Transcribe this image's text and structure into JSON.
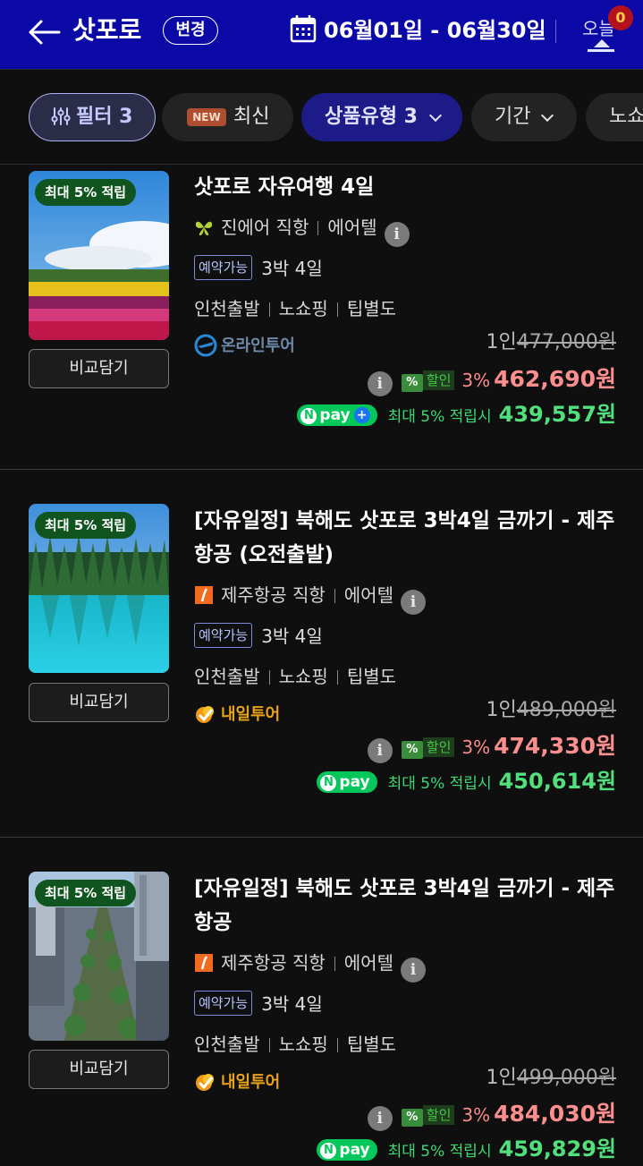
{
  "header": {
    "city": "삿포로",
    "change_label": "변경",
    "dates": "06월01일 - 06월30일",
    "cart_label": "오늘",
    "cart_count": "0",
    "colors": {
      "background": "#0c0aa6",
      "badge": "#b3121d"
    }
  },
  "filters": [
    {
      "label": "필터 3",
      "icon": "sliders-icon"
    },
    {
      "label": "최신",
      "tag": "NEW"
    },
    {
      "label": "상품유형 3",
      "icon": "chevron-down-icon"
    },
    {
      "label": "기간",
      "icon": "chevron-down-icon"
    },
    {
      "label": "노쇼핑"
    }
  ],
  "products": [
    {
      "badge": "최대 5% 적립",
      "compare": "비교담기",
      "title": "삿포로 자유여행 4일",
      "airline": "진에어 직항",
      "hotel": "에어텔",
      "status": "예약가능",
      "nights": "3박 4일",
      "tags": [
        "인천출발",
        "노쇼핑",
        "팁별도"
      ],
      "agency": "온라인투어",
      "per_person": "1인",
      "original_price": "477,000원",
      "discount_label": "할인",
      "discount_pct": "3%",
      "sale_price": "462,690원",
      "npay": "pay",
      "point_text": "최대 5% 적립시",
      "point_price": "439,557원"
    },
    {
      "badge": "최대 5% 적립",
      "compare": "비교담기",
      "title": "[자유일정] 북해도 삿포로 3박4일 금까기 - 제주항공 (오전출발)",
      "airline": "제주항공 직항",
      "hotel": "에어텔",
      "status": "예약가능",
      "nights": "3박 4일",
      "tags": [
        "인천출발",
        "노쇼핑",
        "팁별도"
      ],
      "agency": "내일투어",
      "per_person": "1인",
      "original_price": "489,000원",
      "discount_label": "할인",
      "discount_pct": "3%",
      "sale_price": "474,330원",
      "npay": "pay",
      "point_text": "최대 5% 적립시",
      "point_price": "450,614원"
    },
    {
      "badge": "최대 5% 적립",
      "compare": "비교담기",
      "title": "[자유일정] 북해도 삿포로 3박4일 금까기 - 제주항공",
      "airline": "제주항공 직항",
      "hotel": "에어텔",
      "status": "예약가능",
      "nights": "3박 4일",
      "tags": [
        "인천출발",
        "노쇼핑",
        "팁별도"
      ],
      "agency": "내일투어",
      "per_person": "1인",
      "original_price": "499,000원",
      "discount_label": "할인",
      "discount_pct": "3%",
      "sale_price": "484,030원",
      "npay": "pay",
      "point_text": "최대 5% 적립시",
      "point_price": "459,829원"
    }
  ]
}
